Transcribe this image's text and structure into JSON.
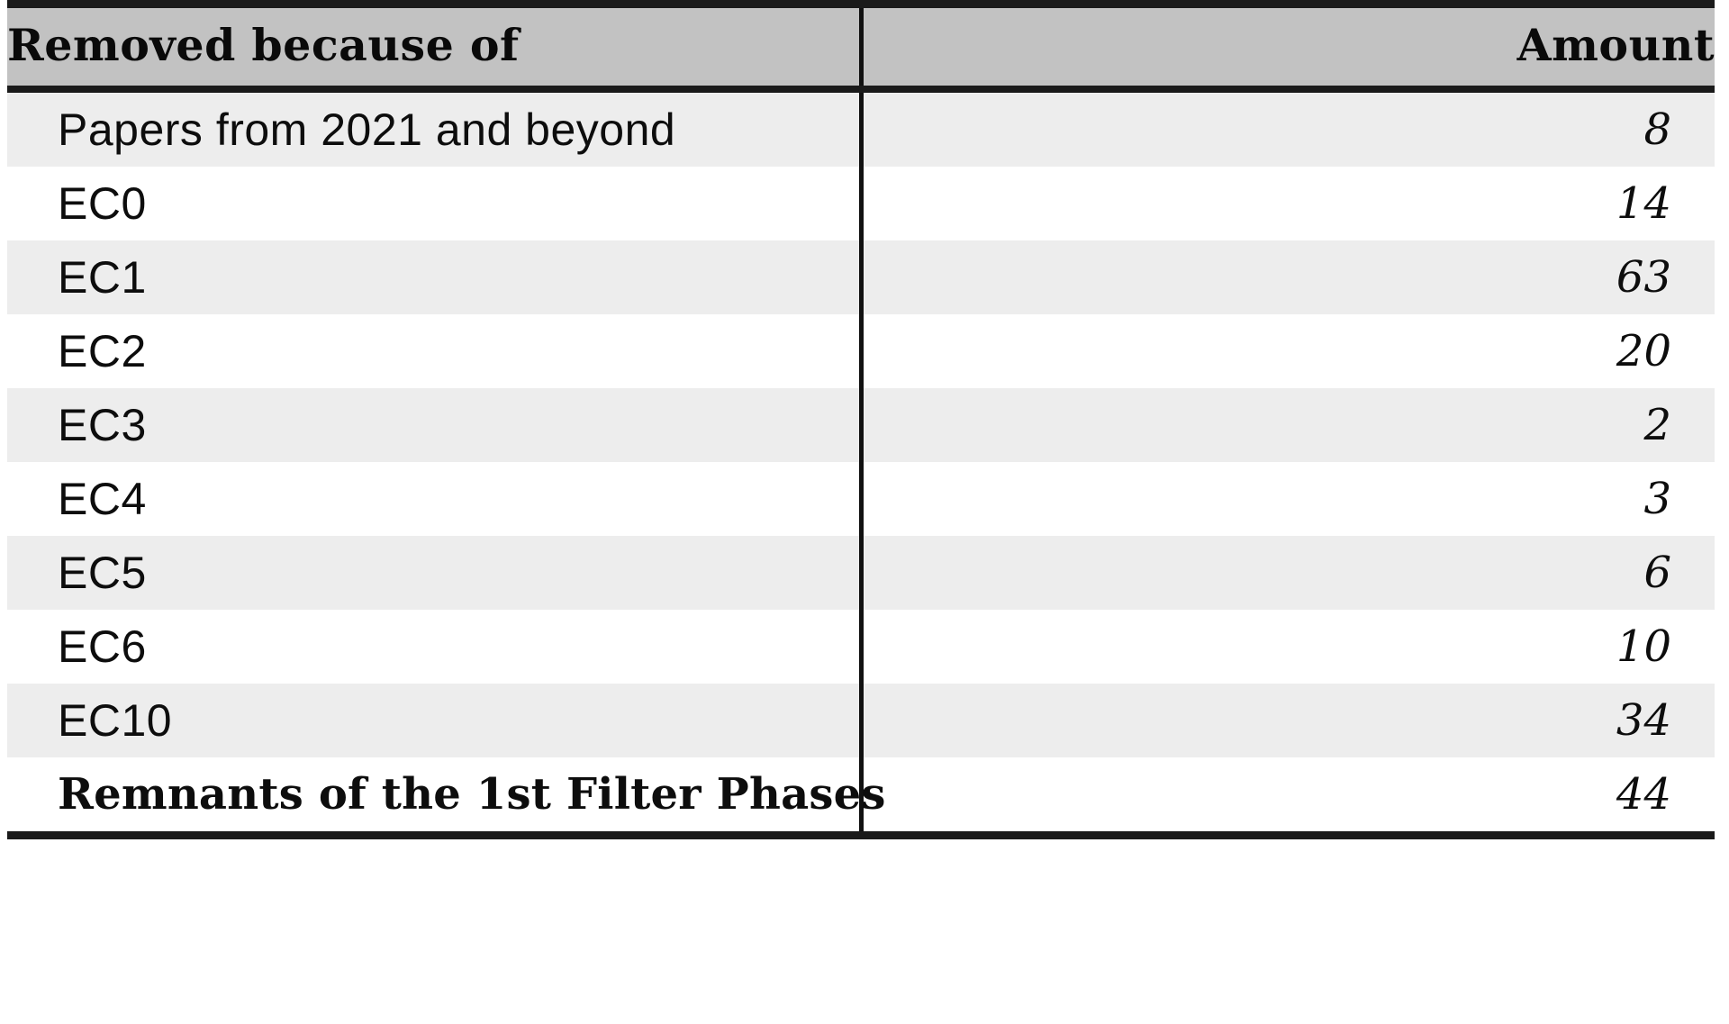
{
  "table": {
    "columns": [
      {
        "key": "reason",
        "label": "Removed because of",
        "align": "left"
      },
      {
        "key": "amount",
        "label": "Amount",
        "align": "right"
      }
    ],
    "rows": [
      {
        "reason": "Papers from 2021 and beyond",
        "amount": "8",
        "emphasis": "normal",
        "stripe": true
      },
      {
        "reason": "EC0",
        "amount": "14",
        "emphasis": "normal",
        "stripe": false
      },
      {
        "reason": "EC1",
        "amount": "63",
        "emphasis": "normal",
        "stripe": true
      },
      {
        "reason": "EC2",
        "amount": "20",
        "emphasis": "normal",
        "stripe": false
      },
      {
        "reason": "EC3",
        "amount": "2",
        "emphasis": "normal",
        "stripe": true
      },
      {
        "reason": "EC4",
        "amount": "3",
        "emphasis": "normal",
        "stripe": false
      },
      {
        "reason": "EC5",
        "amount": "6",
        "emphasis": "normal",
        "stripe": true
      },
      {
        "reason": "EC6",
        "amount": "10",
        "emphasis": "normal",
        "stripe": false
      },
      {
        "reason": "EC10",
        "amount": "34",
        "emphasis": "normal",
        "stripe": true
      },
      {
        "reason": "Remnants of the 1st Filter Phases",
        "amount": "44",
        "emphasis": "bold",
        "stripe": false
      }
    ]
  },
  "colors": {
    "header_background": "#c2c2c2",
    "stripe_background": "#ededed",
    "plain_background": "#ffffff",
    "rule": "#1a1a1a",
    "text": "#0d0d0d"
  }
}
